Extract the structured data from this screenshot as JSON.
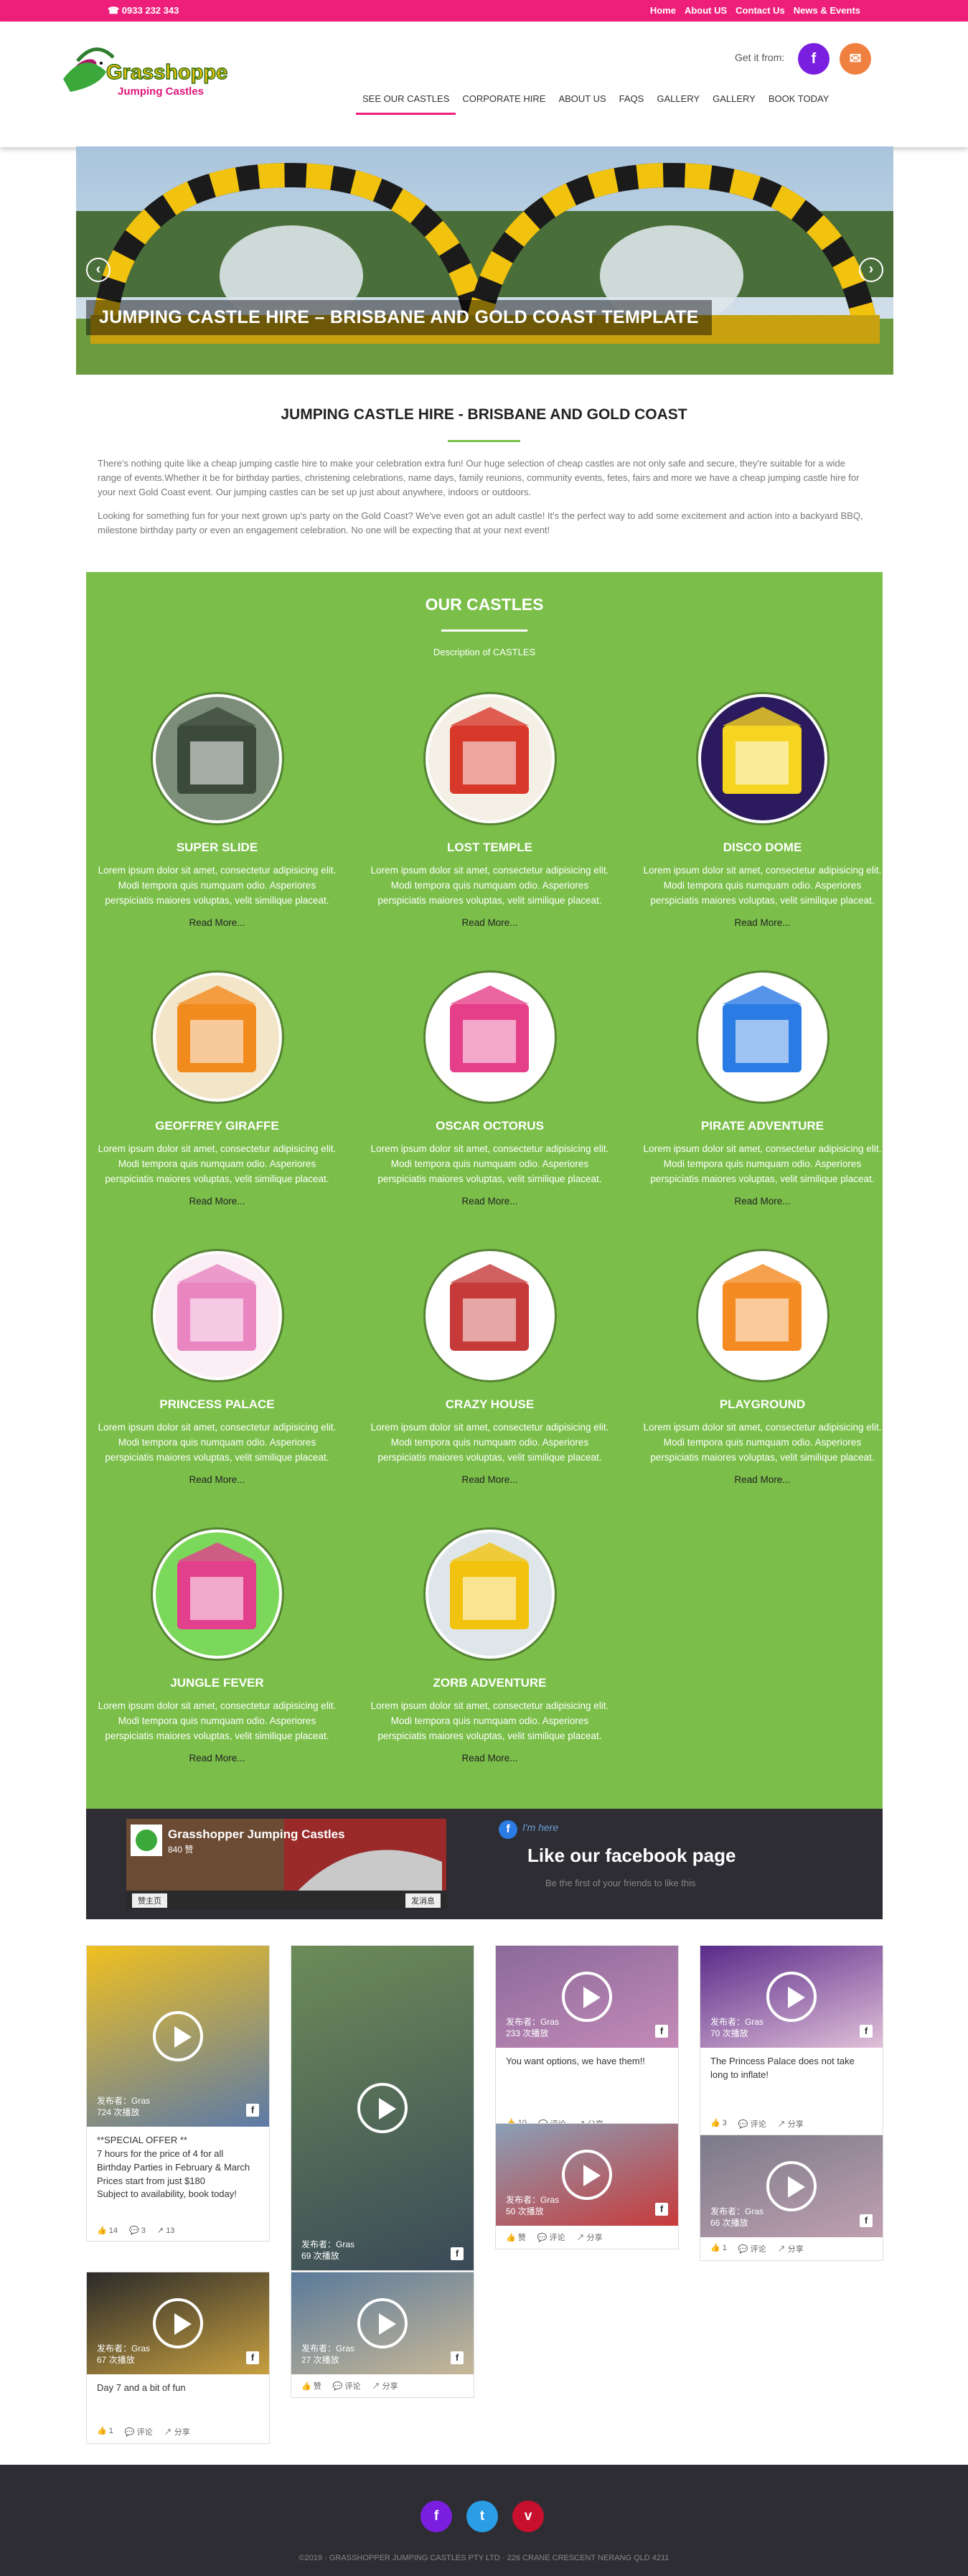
{
  "topbar": {
    "phone": "☎  0933 232 343",
    "links": [
      "Home",
      "About US",
      "Contact Us",
      "News & Events"
    ]
  },
  "header": {
    "logo_text": "Grasshopper",
    "logo_subtext": "Jumping Castles",
    "get_it_from": "Get it from:",
    "nav": [
      "SEE OUR CASTLES",
      "CORPORATE HIRE",
      "ABOUT US",
      "FAQS",
      "GALLERY",
      "GALLERY",
      "BOOK TODAY"
    ]
  },
  "hero": {
    "caption": "JUMPING CASTLE HIRE – BRISBANE AND GOLD COAST TEMPLATE",
    "prev": "‹",
    "next": "›"
  },
  "intro": {
    "title": "JUMPING CASTLE HIRE - BRISBANE AND GOLD COAST",
    "p1": "There's nothing quite like a cheap jumping castle hire to make your celebration extra fun! Our huge selection of cheap castles are not only safe and secure, they're suitable for a wide range of events.Whether it be for birthday parties, christening celebrations, name days, family reunions, community events, fetes, fairs and more we have a cheap jumping castle hire for your next Gold Coast event. Our jumping castles can be set up just about anywhere, indoors or outdoors.",
    "p2": "Looking for something fun for your next grown up's party on the Gold Coast? We've even got an adult castle! It's the perfect way to add some excitement and action into a backyard BBQ, milestone birthday party or even an engagement celebration. No one will be expecting that at your next event!"
  },
  "castles": {
    "title": "OUR CASTLES",
    "description": "Description of CASTLES",
    "lorem": "Lorem ipsum dolor sit amet, consectetur adipisicing elit. Modi tempora quis numquam odio. Asperiores perspiciatis maiores voluptas, velit similique placeat.",
    "read_more": "Read More...",
    "items": [
      {
        "name": "SUPER SLIDE"
      },
      {
        "name": "LOST TEMPLE"
      },
      {
        "name": "DISCO DOME"
      },
      {
        "name": "GEOFFREY GIRAFFE"
      },
      {
        "name": "OSCAR OCTORUS"
      },
      {
        "name": "PIRATE ADVENTURE"
      },
      {
        "name": "PRINCESS PALACE"
      },
      {
        "name": "CRAZY HOUSE"
      },
      {
        "name": "PLAYGROUND"
      },
      {
        "name": "JUNGLE FEVER"
      },
      {
        "name": "ZORB ADVENTURE"
      }
    ]
  },
  "facebook": {
    "page_name": "Grasshopper Jumping Castles",
    "likes": "840 赞",
    "home_btn": "赞主页",
    "send_btn": "发消息",
    "im_here": "I'm here",
    "like_page": "Like our facebook page",
    "first_friends": "Be the first of your friends to like this"
  },
  "posts": [
    {
      "meta1": "发布者：Gras",
      "meta2": "724 次播放",
      "text": "**SPECIAL OFFER **\n7 hours for the price of 4 for all Birthday Parties in February & March\nPrices start from just $180\nSubject to availability, book today!",
      "acts": [
        "14",
        "3",
        "13"
      ]
    },
    {
      "meta1": "发布者：Gras",
      "meta2": "69 次播放",
      "text": "",
      "acts": []
    },
    {
      "meta1": "发布者：Gras",
      "meta2": "233 次播放",
      "text": "You want options, we have them!!",
      "acts": [
        "10",
        "评论",
        "分享"
      ]
    },
    {
      "meta1": "发布者：Gras",
      "meta2": "70 次播放",
      "text": "The Princess Palace does not take long to inflate!",
      "acts": [
        "3",
        "评论",
        "分享"
      ]
    },
    {
      "meta1": "发布者：Gras",
      "meta2": "50 次播放",
      "text": "",
      "acts": [
        "赞",
        "评论",
        "分享"
      ]
    },
    {
      "meta1": "发布者：Gras",
      "meta2": "66 次播放",
      "text": "",
      "acts": [
        "1",
        "评论",
        "分享"
      ]
    },
    {
      "meta1": "发布者：Gras",
      "meta2": "67 次播放",
      "text": "Day 7 and a bit of fun",
      "acts": [
        "1",
        "评论",
        "分享"
      ]
    },
    {
      "meta1": "发布者：Gras",
      "meta2": "27 次播放",
      "text": "",
      "acts": [
        "赞",
        "评论",
        "分享"
      ]
    }
  ],
  "footer": {
    "copyright": "©2019 · GRASSHOPPER JUMPING CASTLES PTY LTD · 226 CRANE CRESCENT NERANG QLD 4211",
    "icons": [
      "f",
      "t",
      "v"
    ]
  },
  "colors": {
    "pink": "#ee1f7a",
    "green": "#7bbf4a",
    "dark": "#2d2d33",
    "purple": "#7a1fe0",
    "orange": "#f08040",
    "twitter": "#2a9de6",
    "vimeo": "#c8102e"
  }
}
